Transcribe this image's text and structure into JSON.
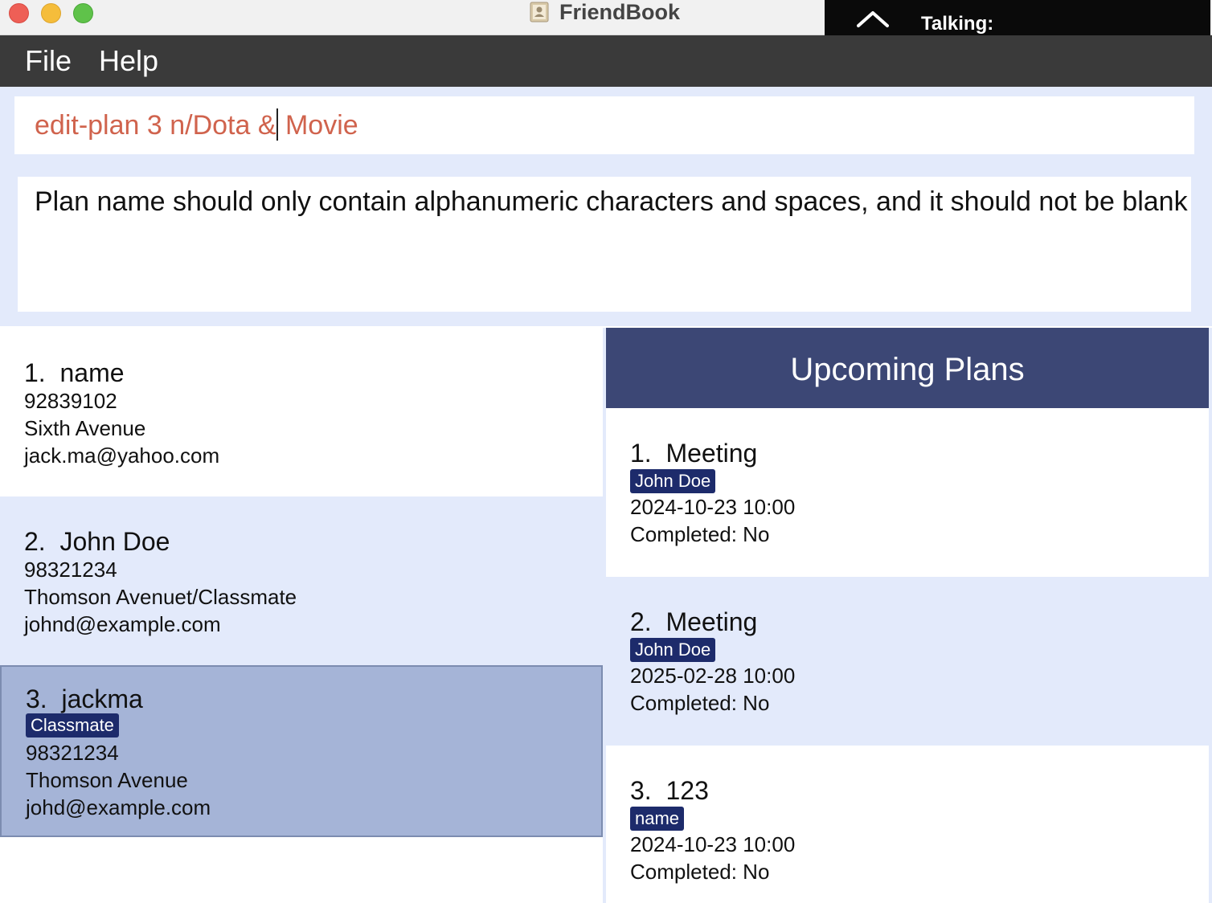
{
  "window": {
    "title": "FriendBook",
    "app_icon": "contacts-book-icon"
  },
  "overlay": {
    "label": "Talking:",
    "icon": "chevron-up-icon"
  },
  "menu": {
    "file": "File",
    "help": "Help"
  },
  "command": {
    "value_before_caret": "edit-plan 3 n/Dota &",
    "value_after_caret": " Movie"
  },
  "result": {
    "message": "Plan name should only contain alphanumeric characters and spaces, and it should not be blank"
  },
  "persons": [
    {
      "index": "1.",
      "name": "name",
      "phone": "92839102",
      "address": "Sixth Avenue",
      "email": "jack.ma@yahoo.com"
    },
    {
      "index": "2.",
      "name": "John Doe",
      "phone": "98321234",
      "address": "Thomson Avenuet/Classmate",
      "email": "johnd@example.com"
    },
    {
      "index": "3.",
      "name": "jackma",
      "tag": "Classmate",
      "phone": "98321234",
      "address": "Thomson Avenue",
      "email": "johd@example.com"
    }
  ],
  "plans": {
    "header": "Upcoming Plans",
    "items": [
      {
        "index": "1.",
        "name": "Meeting",
        "tag": "John Doe",
        "datetime": "2024-10-23 10:00",
        "completed": "Completed: No"
      },
      {
        "index": "2.",
        "name": "Meeting",
        "tag": "John Doe",
        "datetime": "2025-02-28 10:00",
        "completed": "Completed: No"
      },
      {
        "index": "3.",
        "name": "123",
        "tag": "name",
        "datetime": "2024-10-23 10:00",
        "completed": "Completed: No"
      }
    ]
  },
  "colors": {
    "menubar": "#3a3a3a",
    "command_text": "#d0634d",
    "panel_bg": "#e3eafb",
    "selected_card": "#a5b4d7",
    "tag_bg": "#1d2b6b",
    "plans_header": "#3c4775"
  }
}
